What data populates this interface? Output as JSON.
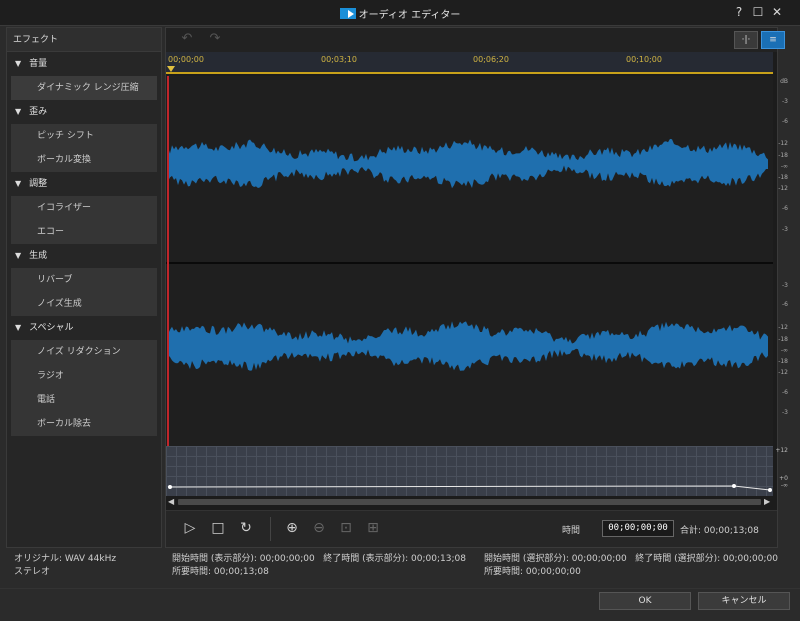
{
  "window": {
    "title": "オーディオ エディター",
    "help_label": "?",
    "max_label": "☐",
    "close_label": "✕"
  },
  "sidebar": {
    "header": "エフェクト",
    "groups": [
      {
        "label": "音量",
        "items": [
          "ダイナミック レンジ圧縮"
        ]
      },
      {
        "label": "歪み",
        "items": [
          "ピッチ シフト",
          "ボーカル変換"
        ]
      },
      {
        "label": "調整",
        "items": [
          "イコライザー",
          "エコー"
        ]
      },
      {
        "label": "生成",
        "items": [
          "リバーブ",
          "ノイズ生成"
        ]
      },
      {
        "label": "スペシャル",
        "items": [
          "ノイズ リダクション",
          "ラジオ",
          "電話",
          "ボーカル除去"
        ]
      }
    ]
  },
  "toolbar": {
    "undo_icon": "undo-icon",
    "redo_icon": "redo-icon",
    "mode1_icon": "waveform-mode-icon",
    "mode2_icon": "equalizer-mode-icon"
  },
  "ruler": {
    "ticks": [
      "00;00;00",
      "00;03;10",
      "00;06;20",
      "00;10;00"
    ]
  },
  "db_scale": {
    "unit": "dB",
    "ch1": [
      "-3",
      "-6",
      "-12",
      "-18",
      "-∞",
      "-18",
      "-12",
      "-6",
      "-3"
    ],
    "ch2": [
      "-3",
      "-6",
      "-12",
      "-18",
      "-∞",
      "-18",
      "-12",
      "-6",
      "-3"
    ]
  },
  "envelope_scale": {
    "top": "+12",
    "mid": "+0",
    "bottom": "-∞"
  },
  "transport": {
    "time_label": "時間",
    "time_value": "00;00;00;00",
    "total": "合計: 00;00;13;08"
  },
  "info": {
    "original": "オリジナル: WAV 44kHz",
    "channels": "ステレオ",
    "view_start": "開始時間 (表示部分): 00;00;00;00",
    "view_end": "終了時間 (表示部分): 00;00;13;08",
    "view_duration": "所要時間: 00;00;13;08",
    "sel_start": "開始時間 (選択部分): 00;00;00;00",
    "sel_end": "終了時間 (選択部分): 00;00;00;00",
    "sel_duration": "所要時間: 00;00;00;00"
  },
  "footer": {
    "ok": "OK",
    "cancel": "キャンセル"
  },
  "colors": {
    "waveform": "#1f6fae",
    "playhead": "#c0262b",
    "ruler_text": "#d0b443",
    "accent": "#1a6fb5"
  }
}
